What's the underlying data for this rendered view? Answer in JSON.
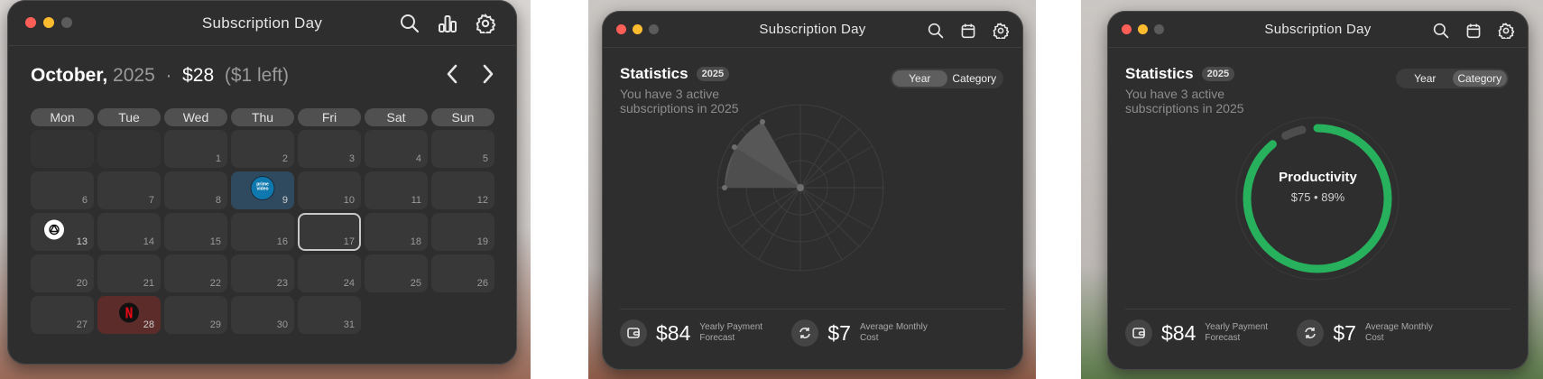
{
  "app_title": "Subscription Day",
  "calendar": {
    "month": "October",
    "year": "2025",
    "separator": "·",
    "amount": "$28",
    "remaining": "($1 left)",
    "weekdays": [
      "Mon",
      "Tue",
      "Wed",
      "Thu",
      "Fri",
      "Sat",
      "Sun"
    ],
    "days": [
      "",
      "",
      "1",
      "2",
      "3",
      "4",
      "5",
      "6",
      "7",
      "8",
      "9",
      "10",
      "11",
      "12",
      "13",
      "14",
      "15",
      "16",
      "17",
      "18",
      "19",
      "20",
      "21",
      "22",
      "23",
      "24",
      "25",
      "26",
      "27",
      "28",
      "29",
      "30",
      "31"
    ],
    "today": "17",
    "subscriptions": [
      {
        "day": "9",
        "service": "prime video",
        "icon": "prime-video-icon",
        "color": "#2f4a5e"
      },
      {
        "day": "13",
        "service": "ChatGPT",
        "icon": "openai-icon",
        "color": "#383838"
      },
      {
        "day": "28",
        "service": "Netflix",
        "icon": "netflix-icon",
        "color": "#5b2c2a"
      }
    ],
    "prime_text": "prime video"
  },
  "stats": {
    "title": "Statistics",
    "year_badge": "2025",
    "subtitle": "You have 3 active subscriptions in 2025",
    "tabs": [
      "Year",
      "Category"
    ],
    "active_tab_view1": "Year",
    "active_tab_view2": "Category",
    "yearly_value": "$84",
    "yearly_label": "Yearly Payment Forecast",
    "monthly_value": "$7",
    "monthly_label": "Average Monthly Cost",
    "category_name": "Productivity",
    "category_value": "$75 • 89%",
    "category_fraction": 0.89,
    "accent": "#28b15c"
  }
}
